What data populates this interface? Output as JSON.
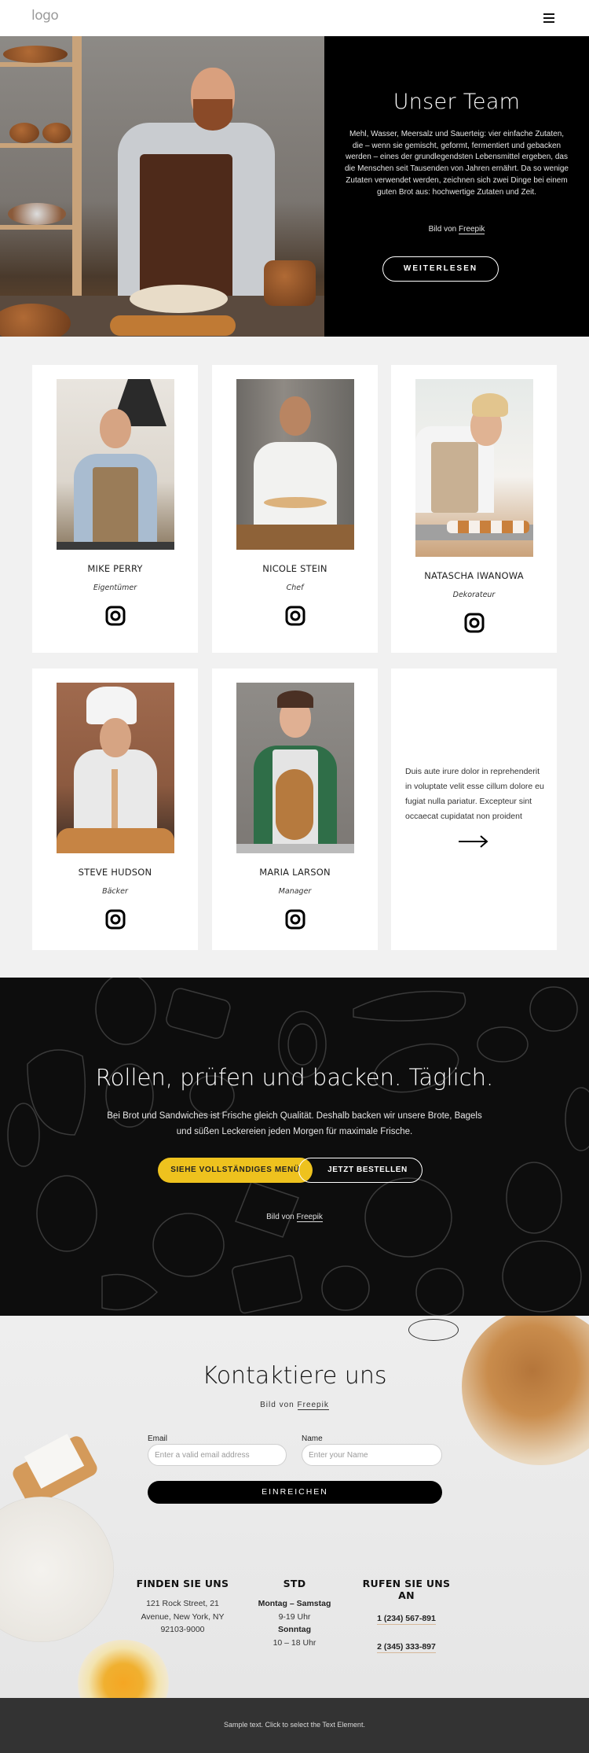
{
  "header": {
    "logo": "logo",
    "menu_icon": "hamburger-menu-icon"
  },
  "hero": {
    "title": "Unser Team",
    "body": "Mehl, Wasser, Meersalz und Sauerteig: vier einfache Zutaten, die – wenn sie gemischt, geformt, fermentiert und gebacken werden – eines der grundlegendsten Lebensmittel ergeben, das die Menschen seit Tausenden von Jahren ernährt. Da so wenige Zutaten verwendet werden, zeichnen sich zwei Dinge bei einem guten Brot aus: hochwertige Zutaten und Zeit.",
    "credit_prefix": "Bild von",
    "credit_link": "Freepik",
    "button": "WEITERLESEN"
  },
  "team": {
    "members": [
      {
        "name": "MIKE PERRY",
        "role": "Eigentümer",
        "icon": "instagram-icon"
      },
      {
        "name": "NICOLE STEIN",
        "role": "Chef",
        "icon": "instagram-icon"
      },
      {
        "name": "NATASCHA IWANOWA",
        "role": "Dekorateur",
        "icon": "instagram-icon"
      },
      {
        "name": "STEVE HUDSON",
        "role": "Bäcker",
        "icon": "instagram-icon"
      },
      {
        "name": "MARIA LARSON",
        "role": "Manager",
        "icon": "instagram-icon"
      }
    ],
    "more_text": "Duis aute irure dolor in reprehenderit in voluptate velit esse cillum dolore eu fugiat nulla pariatur. Excepteur sint occaecat cupidatat non proident",
    "more_icon": "arrow-right-icon"
  },
  "banner": {
    "title": "Rollen, prüfen und backen. Täglich.",
    "body": "Bei Brot und Sandwiches ist Frische gleich Qualität. Deshalb backen wir unsere Brote, Bagels und süßen Leckereien jeden Morgen für maximale Frische.",
    "primary_button": "SIEHE VOLLSTÄNDIGES MENÜ",
    "secondary_button": "JETZT BESTELLEN",
    "credit_prefix": "Bild von",
    "credit_link": "Freepik",
    "accent_color": "#eec21e"
  },
  "contact": {
    "title": "Kontaktiere uns",
    "credit_prefix": "Bild von",
    "credit_link": "Freepik",
    "email_label": "Email",
    "email_placeholder": "Enter a valid email address",
    "email_value": "",
    "name_label": "Name",
    "name_placeholder": "Enter your Name",
    "name_value": "",
    "submit": "EINREICHEN",
    "find_us": {
      "heading": "FINDEN SIE UNS",
      "lines": [
        "121 Rock Street, 21",
        "Avenue, New York, NY",
        "92103-9000"
      ]
    },
    "hours": {
      "heading": "STD",
      "day1": "Montag – Samstag",
      "time1": "9-19 Uhr",
      "day2": "Sonntag",
      "time2": "10 – 18 Uhr"
    },
    "call": {
      "heading_line1": "RUFEN SIE UNS",
      "heading_line2": "AN",
      "phone1": "1 (234) 567-891",
      "phone2": "2 (345) 333-897"
    }
  },
  "footer": {
    "text": "Sample text. Click to select the Text Element."
  }
}
